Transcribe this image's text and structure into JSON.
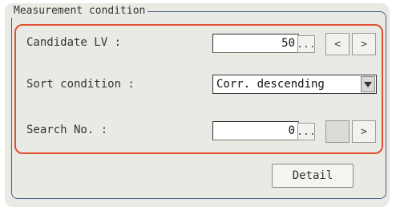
{
  "group": {
    "title": "Measurement condition"
  },
  "candidate_lv": {
    "label": "Candidate LV :",
    "value": "50",
    "browse_label": "...",
    "prev_label": "<",
    "next_label": ">"
  },
  "sort_condition": {
    "label": "Sort condition :",
    "value": "Corr. descending",
    "arrow_icon": "triangle-down-icon"
  },
  "search_no": {
    "label": "Search No. :",
    "value": "0",
    "browse_label": "...",
    "prev_label": "",
    "next_label": ">"
  },
  "detail_button": {
    "label": "Detail"
  },
  "colors": {
    "panel_bg": "#eaeae4",
    "group_border": "#4a5c90",
    "highlight_border": "#e05030"
  }
}
